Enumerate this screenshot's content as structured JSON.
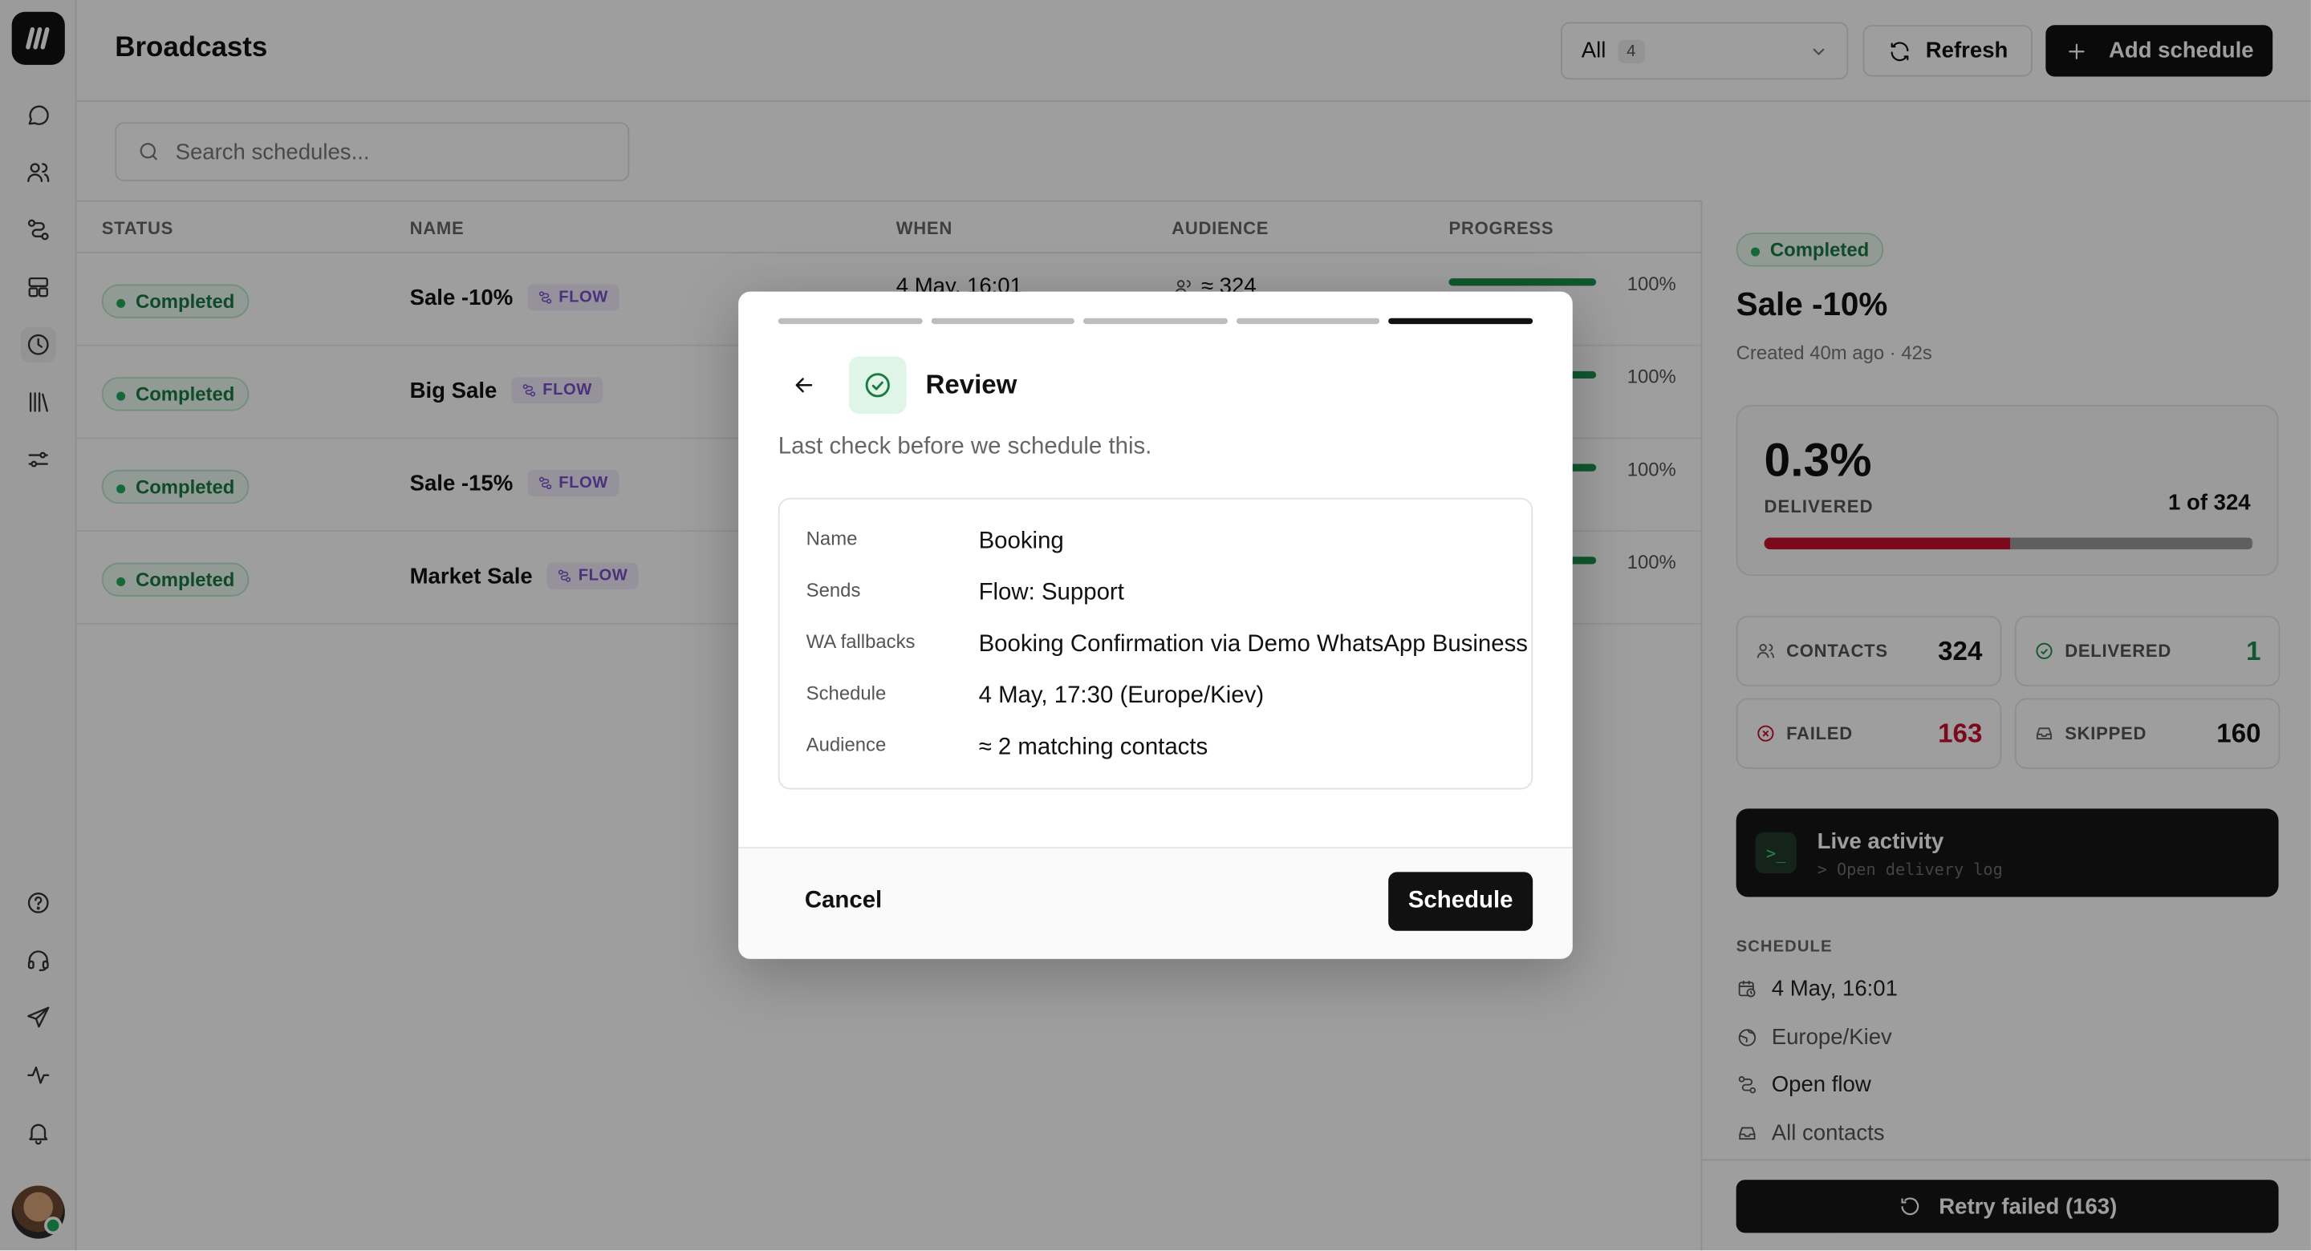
{
  "header": {
    "title": "Broadcasts",
    "filter": {
      "value": "All",
      "count": "4"
    },
    "refresh_label": "Refresh",
    "add_label": "Add schedule"
  },
  "search": {
    "placeholder": "Search schedules..."
  },
  "table": {
    "columns": [
      "STATUS",
      "NAME",
      "WHEN",
      "AUDIENCE",
      "PROGRESS"
    ],
    "rows": [
      {
        "status": "Completed",
        "name": "Sale -10%",
        "tag": "FLOW",
        "when": "4 May, 16:01",
        "audience": "≈ 324",
        "progress": 1.0,
        "progress_label": "100%"
      },
      {
        "status": "Completed",
        "name": "Big Sale",
        "tag": "FLOW",
        "progress": 1.0,
        "progress_label": "100%"
      },
      {
        "status": "Completed",
        "name": "Sale -15%",
        "tag": "FLOW",
        "progress": 1.0,
        "progress_label": "100%"
      },
      {
        "status": "Completed",
        "name": "Market Sale",
        "tag": "FLOW",
        "progress": 1.0,
        "progress_label": "100%"
      }
    ]
  },
  "panel": {
    "status": "Completed",
    "title": "Sale -10%",
    "meta": "Created 40m ago · 42s",
    "delivered_pct": "0.3%",
    "delivered_label": "DELIVERED",
    "delivered_of": "1 of 324",
    "bar": {
      "failed_fraction": 0.503,
      "skipped_fraction": 0.494
    },
    "stats": {
      "contacts": {
        "label": "CONTACTS",
        "value": "324"
      },
      "delivered": {
        "label": "DELIVERED",
        "value": "1"
      },
      "failed": {
        "label": "FAILED",
        "value": "163"
      },
      "skipped": {
        "label": "SKIPPED",
        "value": "160"
      }
    },
    "live": {
      "title": "Live activity",
      "sub": "> Open delivery log",
      "icon_text": ">_"
    },
    "schedule_heading": "SCHEDULE",
    "schedule": {
      "date": "4 May, 16:01",
      "timezone": "Europe/Kiev",
      "flow_link": "Open flow",
      "audience": "All contacts"
    },
    "retry_label": "Retry failed (163)"
  },
  "modal": {
    "steps_total": 5,
    "step_active": 5,
    "title": "Review",
    "subtitle": "Last check before we schedule this.",
    "fields": [
      {
        "key": "Name",
        "value": "Booking"
      },
      {
        "key": "Sends",
        "value": "Flow: Support"
      },
      {
        "key": "WA fallbacks",
        "value": "Booking Confirmation via Demo WhatsApp Business"
      },
      {
        "key": "Schedule",
        "value": "4 May, 17:30 (Europe/Kiev)"
      },
      {
        "key": "Audience",
        "value": "≈ 2 matching contacts"
      }
    ],
    "cancel_label": "Cancel",
    "schedule_label": "Schedule"
  },
  "colors": {
    "accent_dark": "#111111",
    "success": "#1a8f4c",
    "failed": "#c8102e",
    "flow_tag": "#7a4fc9"
  }
}
